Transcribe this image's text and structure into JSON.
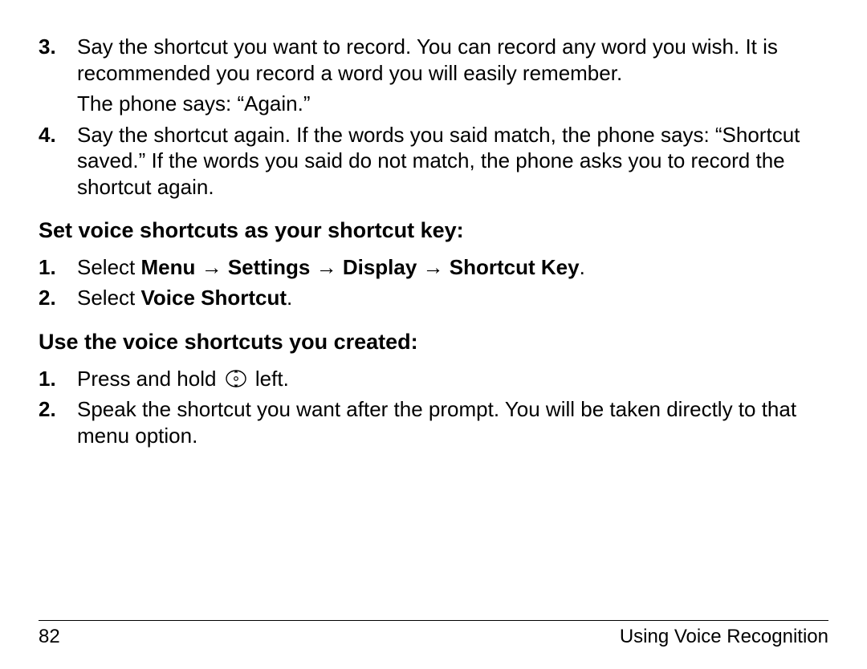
{
  "steps_initial": [
    {
      "num": "3.",
      "text_main": "Say the shortcut you want to record. You can record any word you wish. It is recommended you record a word you will easily remember.",
      "text_sub": "The phone says: “Again.”"
    },
    {
      "num": "4.",
      "text_main": "Say the shortcut again. If the words you said match, the phone says: “Shortcut saved.” If the words you said do not match, the phone asks you to record the shortcut again.",
      "text_sub": ""
    }
  ],
  "heading1": "Set voice shortcuts as your shortcut key:",
  "steps_set": [
    {
      "num": "1.",
      "prefix": "Select ",
      "bold": "Menu → Settings → Display → Shortcut Key",
      "suffix": "."
    },
    {
      "num": "2.",
      "prefix": "Select ",
      "bold": "Voice Shortcut",
      "suffix": "."
    }
  ],
  "heading2": "Use the voice shortcuts you created:",
  "steps_use": [
    {
      "num": "1.",
      "prefix": "Press and hold ",
      "suffix": " left."
    },
    {
      "num": "2.",
      "text": "Speak the shortcut you want after the prompt. You will be taken directly to that menu option."
    }
  ],
  "footer": {
    "page_number": "82",
    "section": "Using Voice Recognition"
  }
}
